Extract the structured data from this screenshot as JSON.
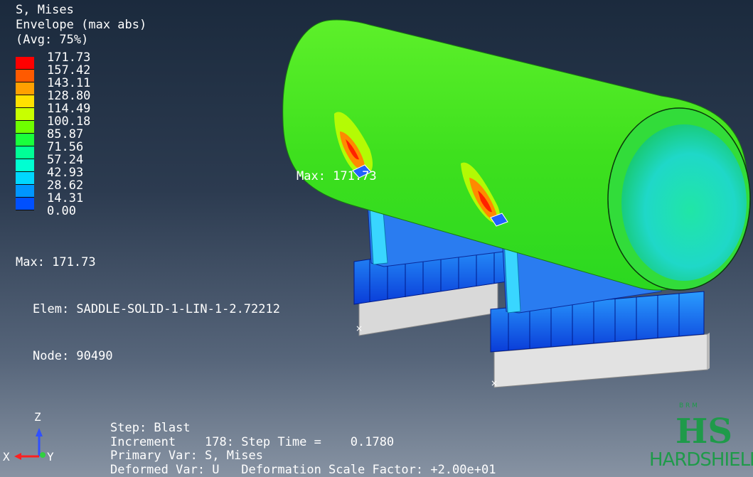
{
  "legend": {
    "title_line1": "S, Mises",
    "title_line2": "Envelope (max abs)",
    "title_line3": "(Avg: 75%)",
    "values": [
      "171.73",
      "157.42",
      "143.11",
      "128.80",
      "114.49",
      "100.18",
      "85.87",
      "71.56",
      "57.24",
      "42.93",
      "28.62",
      "14.31",
      "0.00"
    ],
    "colors": [
      "#ff0000",
      "#ff5a00",
      "#ffa000",
      "#ffe100",
      "#c8ff00",
      "#6eff00",
      "#19ff3c",
      "#00ff96",
      "#00ffd2",
      "#00d7ff",
      "#0096ff",
      "#0050ff",
      "#0a14ff"
    ]
  },
  "max_info": {
    "max": "Max: 171.73",
    "elem": "Elem: SADDLE-SOLID-1-LIN-1-2.72212",
    "node": "Node: 90490"
  },
  "model": {
    "max_label": "Max: 171.73"
  },
  "step": {
    "line1": "Step: Blast",
    "line2": "Increment    178: Step Time =    0.1780",
    "line3": "Primary Var: S, Mises",
    "line4": "Deformed Var: U   Deformation Scale Factor: +2.00e+01"
  },
  "triad": {
    "x": "X",
    "y": "Y",
    "z": "Z"
  },
  "logo": {
    "letters": "B R M",
    "monogram": "HS",
    "name": "HARDSHIELD"
  }
}
